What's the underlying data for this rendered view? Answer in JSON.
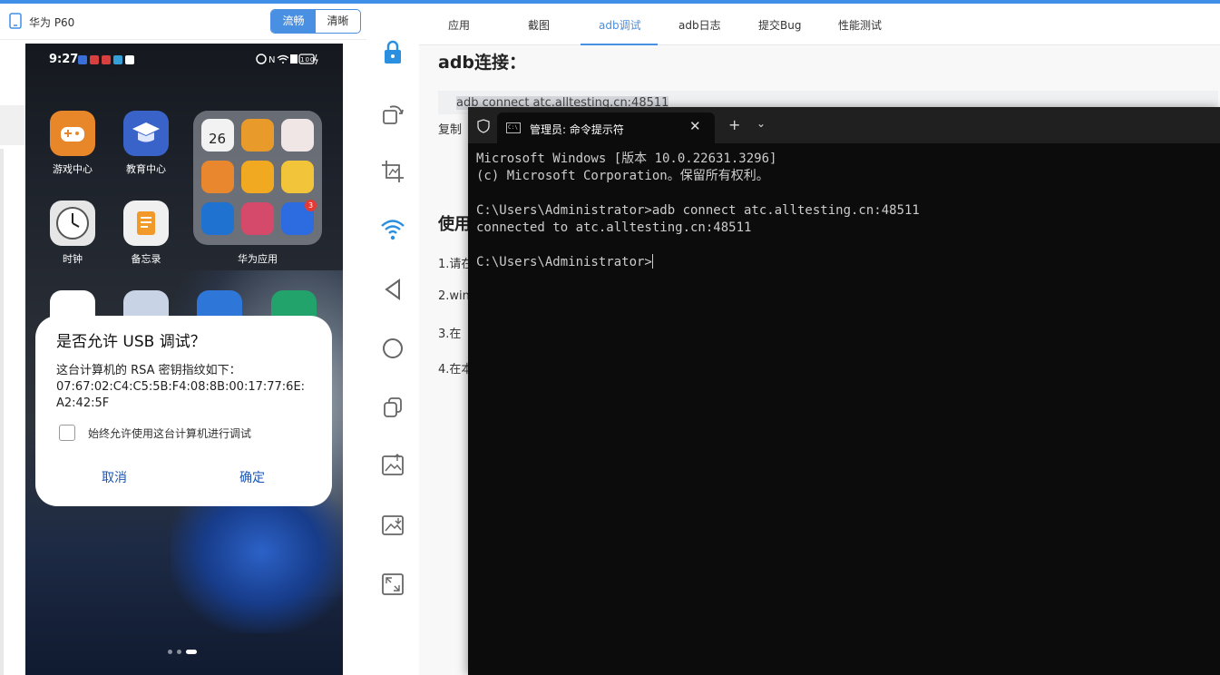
{
  "device": {
    "name": "华为 P60",
    "modes": [
      "流畅",
      "清晰"
    ],
    "active_mode": "流畅"
  },
  "phone": {
    "status_time": "9:27",
    "status_right": "N 100",
    "apps": [
      {
        "label": "游戏中心",
        "color": "#e8862a"
      },
      {
        "label": "教育中心",
        "color": "#3a63c9"
      },
      {
        "label": "时钟",
        "color": "#e6e6e6"
      },
      {
        "label": "备忘录",
        "color": "#f0f0f0"
      }
    ],
    "folder": {
      "label": "华为应用",
      "calendar_day": "26",
      "badge_count": "3"
    },
    "dialog": {
      "title": "是否允许 USB 调试？",
      "body_line1": "这台计算机的 RSA 密钥指纹如下：",
      "body_line2": "07:67:02:C4:C5:5B:F4:08:8B:00:17:77:6E:",
      "body_line3": "A2:42:5F",
      "checkbox_label": "始终允许使用这台计算机进行调试",
      "cancel": "取消",
      "confirm": "确定"
    }
  },
  "tools": [
    "lock-icon",
    "rotate-icon",
    "crop-icon",
    "wifi-icon",
    "back-icon",
    "home-icon",
    "recent-apps-icon",
    "screenshot-icon",
    "save-image-icon",
    "fullscreen-icon"
  ],
  "tabs": [
    "应用",
    "截图",
    "adb调试",
    "adb日志",
    "提交Bug",
    "性能测试"
  ],
  "active_tab": "adb调试",
  "content": {
    "heading": "adb连接：",
    "command": "adb connect atc.alltesting.cn:48511",
    "copy_hint": "复制",
    "usage_heading": "使用",
    "steps": [
      "1.请在",
      "2.win",
      "3.在",
      "4.在本"
    ]
  },
  "terminal": {
    "tab_title": "管理员: 命令提示符",
    "line1": "Microsoft Windows [版本 10.0.22631.3296]",
    "line2": "(c) Microsoft Corporation。保留所有权利。",
    "line3": "C:\\Users\\Administrator>adb connect atc.alltesting.cn:48511",
    "line4": "connected to atc.alltesting.cn:48511",
    "line5": "C:\\Users\\Administrator>"
  },
  "colors": {
    "accent": "#4a90e2",
    "terminal_bg": "#0c0c0c",
    "dialog_button": "#1a56b8"
  }
}
